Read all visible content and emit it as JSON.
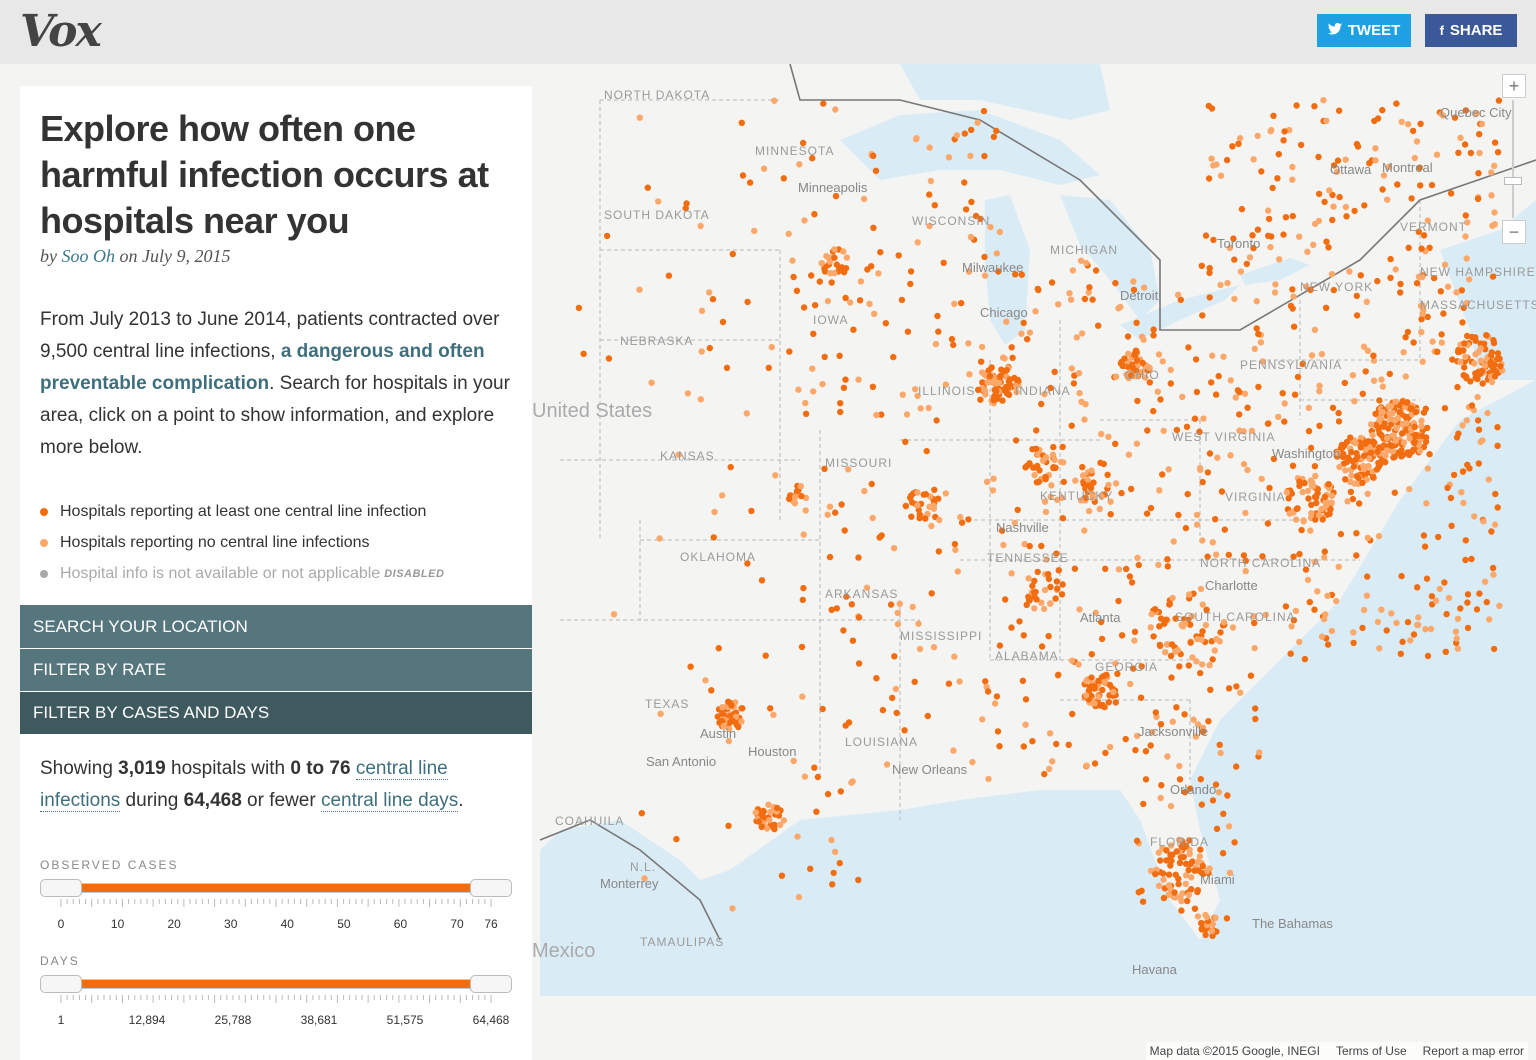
{
  "header": {
    "logo": "Vox",
    "tweet_label": "TWEET",
    "share_label": "SHARE",
    "tweet_color": "#1da1e2",
    "share_color": "#3b5998"
  },
  "panel": {
    "title": "Explore how often one harmful infection occurs at hospitals near you",
    "byline_prefix": "by",
    "author": "Soo Oh",
    "byline_date": "on July 9, 2015",
    "intro_part1": "From July 2013 to June 2014, patients contracted over 9,500 central line infections, ",
    "intro_link": "a dangerous and often preventable complication",
    "intro_part2": ". Search for hospitals in your area, click on a point to show information, and explore more below.",
    "legend": [
      {
        "label": "Hospitals reporting at least one central line infection",
        "color": "#f26d10"
      },
      {
        "label": "Hospitals reporting no central line infections",
        "color": "#fba86a"
      },
      {
        "label": "Hospital info is not available or not applicable",
        "color": "#aaaaaa",
        "tag": "DISABLED"
      }
    ],
    "accordion": {
      "search": "SEARCH YOUR LOCATION",
      "rate": "FILTER BY RATE",
      "cases_days": "FILTER BY CASES AND DAYS"
    },
    "showing": {
      "prefix": "Showing ",
      "count": "3,019",
      "mid1": " hospitals with ",
      "range": "0 to 76",
      "link1": "central line infections",
      "mid2": " during ",
      "days": "64,468",
      "mid3": " or fewer ",
      "link2": "central line days",
      "end": "."
    },
    "cases_slider": {
      "label": "OBSERVED CASES",
      "min": 0,
      "max": 76,
      "low": 0,
      "high": 76,
      "ticks": [
        "0",
        "10",
        "20",
        "30",
        "40",
        "50",
        "60",
        "70",
        "76"
      ]
    },
    "days_slider": {
      "label": "DAYS",
      "min": 1,
      "max": 64468,
      "low": 1,
      "high": 64468,
      "ticks": [
        "1",
        "12,894",
        "25,788",
        "38,681",
        "51,575",
        "64,468"
      ]
    }
  },
  "map": {
    "zoom_in": "+",
    "zoom_out": "−",
    "country_labels": [
      "United States",
      "Mexico"
    ],
    "state_labels": [
      "NORTH DAKOTA",
      "SOUTH DAKOTA",
      "MINNESOTA",
      "NEBRASKA",
      "IOWA",
      "KANSAS",
      "MISSOURI",
      "OKLAHOMA",
      "ARKANSAS",
      "TEXAS",
      "WISCONSIN",
      "MICHIGAN",
      "ILLINOIS",
      "INDIANA",
      "OHIO",
      "KENTUCKY",
      "TENNESSEE",
      "MISSISSIPPI",
      "ALABAMA",
      "GEORGIA",
      "FLORIDA",
      "LOUISIANA",
      "WEST VIRGINIA",
      "VIRGINIA",
      "NORTH CAROLINA",
      "SOUTH CAROLINA",
      "PENNSYLVANIA",
      "NEW YORK",
      "VERMONT",
      "NEW HAMPSHIRE",
      "MASSACHUSETTS",
      "COAHUILA",
      "TAMAULIPAS",
      "N.L."
    ],
    "city_labels": [
      "Minneapolis",
      "Milwaukee",
      "Chicago",
      "Detroit",
      "Toronto",
      "Ottawa",
      "Montreal",
      "Quebec City",
      "Nashville",
      "Charlotte",
      "Atlanta",
      "Jacksonville",
      "Orlando",
      "Miami",
      "New Orleans",
      "Houston",
      "San Antonio",
      "Austin",
      "Monterrey",
      "Havana",
      "The Bahamas",
      "Washington"
    ],
    "attribution": "Map data ©2015 Google, INEGI",
    "terms": "Terms of Use",
    "report": "Report a map error",
    "dot_color_infection": "#f26d10",
    "dot_color_none": "#fba86a",
    "water_color": "#d9ecf6"
  }
}
